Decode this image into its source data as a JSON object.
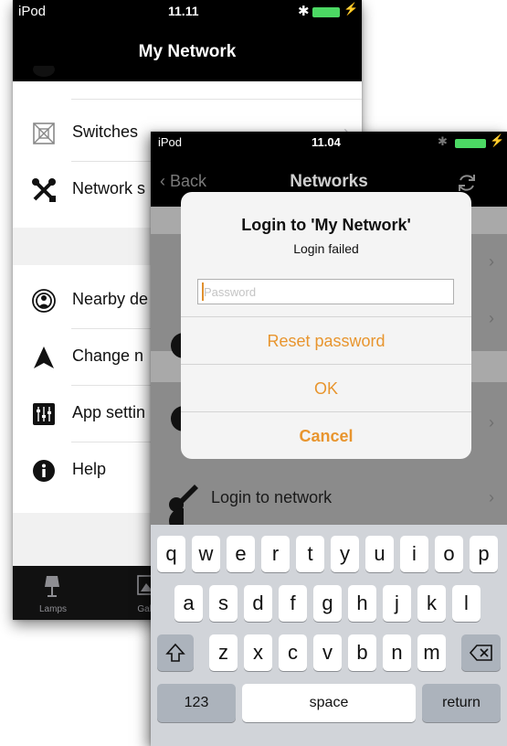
{
  "back_screen": {
    "status": {
      "carrier": "iPod",
      "time": "11.11"
    },
    "title": "My Network",
    "rows": [
      {
        "label": "Switches",
        "icon": "switch-icon"
      },
      {
        "label": "Network s",
        "icon": "tools-icon"
      },
      {
        "label": "Nearby de",
        "icon": "nearby-icon"
      },
      {
        "label": "Change n",
        "icon": "arrow-icon"
      },
      {
        "label": "App settin",
        "icon": "sliders-icon"
      },
      {
        "label": "Help",
        "icon": "info-icon"
      }
    ],
    "tabs": [
      {
        "label": "Lamps",
        "icon": "lamp-icon"
      },
      {
        "label": "Galle",
        "icon": "gallery-icon"
      }
    ]
  },
  "front_screen": {
    "status": {
      "carrier": "iPod",
      "time": "11.04"
    },
    "nav": {
      "back_label": "Back",
      "title": "Networks"
    },
    "list": {
      "login_row_label": "Login to network"
    },
    "dialog": {
      "title": "Login to 'My Network'",
      "message": "Login failed",
      "password_placeholder": "Password",
      "password_value": "",
      "reset_label": "Reset password",
      "ok_label": "OK",
      "cancel_label": "Cancel"
    },
    "keyboard": {
      "row1": [
        "q",
        "w",
        "e",
        "r",
        "t",
        "y",
        "u",
        "i",
        "o",
        "p"
      ],
      "row2": [
        "a",
        "s",
        "d",
        "f",
        "g",
        "h",
        "j",
        "k",
        "l"
      ],
      "row3": [
        "z",
        "x",
        "c",
        "v",
        "b",
        "n",
        "m"
      ],
      "numbers_label": "123",
      "space_label": "space",
      "return_label": "return"
    }
  },
  "colors": {
    "accent": "#e8952e",
    "battery": "#4cd964",
    "header": "#000000"
  }
}
